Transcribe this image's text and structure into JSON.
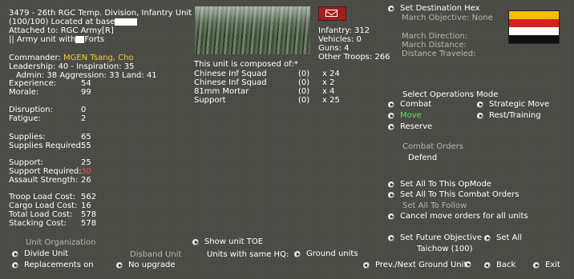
{
  "unit": {
    "title": "3479 - 26th RGC Temp. Division, Infantry Unit",
    "status_line": "(100/100) Located at base",
    "attached": "Attached to: RGC Army[R]",
    "type_prefix": "|| Army unit with",
    "type_suffix": "Forts"
  },
  "commander": {
    "label": "Commander:",
    "name": "MGEN Tsang, Cho",
    "leadership": "Leadership: 40 - Inspiration: 35",
    "ratings": "Admin: 38  Aggression: 33  Land: 41"
  },
  "stats": [
    {
      "label": "Experience:",
      "value": "54"
    },
    {
      "label": "Morale:",
      "value": "99"
    },
    {
      "label": "Disruption:",
      "value": "0"
    },
    {
      "label": "Fatigue:",
      "value": "2"
    },
    {
      "label": "Supplies:",
      "value": "65"
    },
    {
      "label": "Supplies Required:",
      "value": "55"
    },
    {
      "label": "Support:",
      "value": "25"
    },
    {
      "label": "Support Required:",
      "value": "30"
    },
    {
      "label": "Assault Strength:",
      "value": "26"
    },
    {
      "label": "Troop Load Cost:",
      "value": "562"
    },
    {
      "label": "Cargo Load Cost:",
      "value": "16"
    },
    {
      "label": "Total Load Cost:",
      "value": "578"
    },
    {
      "label": "Stacking Cost:",
      "value": "578"
    }
  ],
  "counts": {
    "infantry": "Infantry: 312",
    "vehicles": "Vehicles: 0",
    "guns": "Guns: 4",
    "other": "Other Troops: 266"
  },
  "composition": {
    "header": "This unit is composed of:*",
    "rows": [
      {
        "name": "Chinese Inf Squad",
        "damaged": "(0)",
        "count": "x 24"
      },
      {
        "name": "Chinese Inf Squad",
        "damaged": "(0)",
        "count": "x 2"
      },
      {
        "name": "81mm Mortar",
        "damaged": "(0)",
        "count": "x 4"
      },
      {
        "name": "Support",
        "damaged": "(0)",
        "count": "x 25"
      }
    ]
  },
  "march": {
    "set_destination": "Set Destination Hex",
    "objective": "March Objective: None",
    "direction": "March Direction:",
    "distance": "March Distance:",
    "traveled": "Distance Traveled:"
  },
  "flag_colors": [
    "#f0c000",
    "#d82020",
    "#ffffff",
    "#101010"
  ],
  "opmode": {
    "header": "Select Operations Mode",
    "combat": "Combat",
    "strategic": "Strategic Move",
    "move": "Move",
    "rest": "Rest/Training",
    "reserve": "Reserve",
    "orders_header": "Combat Orders",
    "orders_value": "Defend"
  },
  "actions": {
    "set_all_opmode": "Set All To This OpMode",
    "set_all_combat": "Set All To This Combat Orders",
    "set_all_follow": "Set All To Follow",
    "cancel_move": "Cancel move orders for all units",
    "set_future": "Set Future Objective",
    "set_all": "Set All",
    "future_target": "Taichow (100)"
  },
  "bottom": {
    "unit_org": "Unit Organization",
    "divide": "Divide Unit",
    "disband": "Disband Unit",
    "replacements": "Replacements on",
    "no_upgrade": "No upgrade",
    "show_toe": "Show unit TOE",
    "same_hq": "Units with same HQ:",
    "ground_units": "Ground units",
    "prev_next": "Prev./Next Ground Unit",
    "back": "Back",
    "exit": "Exit"
  },
  "colors": {
    "background": "#4a4a44",
    "commander": "#f0d040",
    "warning": "#e05050",
    "selected": "#5ee05e"
  }
}
